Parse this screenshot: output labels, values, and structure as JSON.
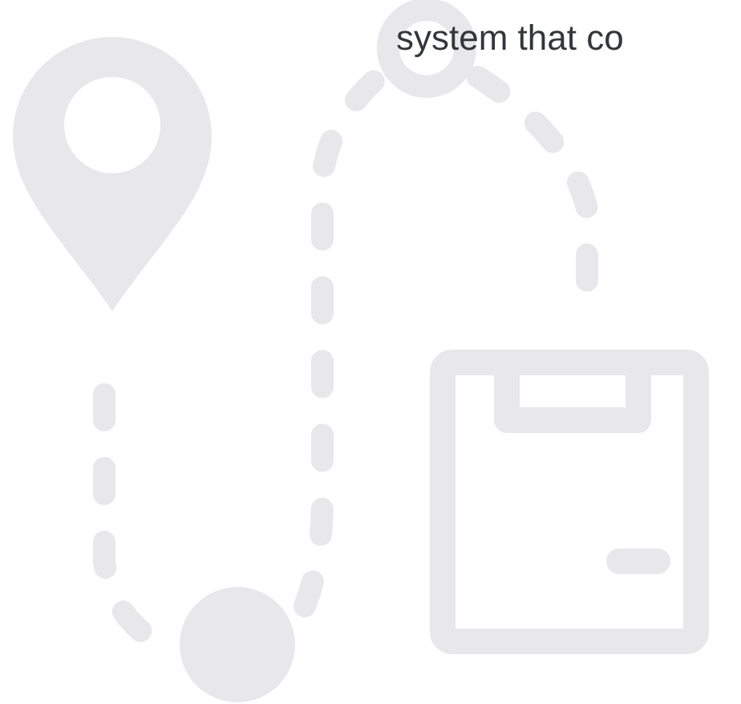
{
  "caption": {
    "text": "system that co"
  }
}
